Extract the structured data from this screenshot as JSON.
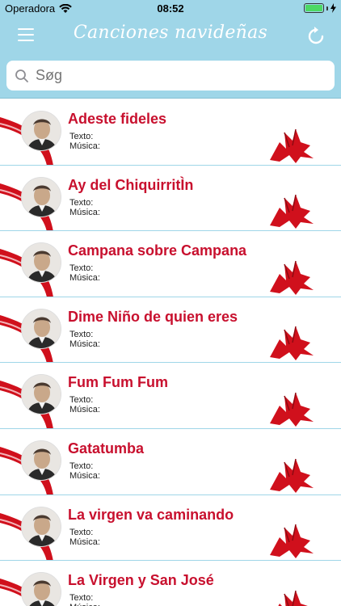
{
  "status_bar": {
    "carrier": "Operadora",
    "time": "08:52"
  },
  "nav": {
    "title": "Canciones navideñas"
  },
  "search": {
    "placeholder": "Søg"
  },
  "songs": [
    {
      "title": "Adeste fideles",
      "texto_label": "Texto:",
      "musica_label": "Música:"
    },
    {
      "title": "Ay del ChiquirritÌn",
      "texto_label": "Texto:",
      "musica_label": "Música:"
    },
    {
      "title": "Campana sobre Campana",
      "texto_label": "Texto:",
      "musica_label": "Música:"
    },
    {
      "title": "Dime Niño de quien eres",
      "texto_label": "Texto:",
      "musica_label": "Música:"
    },
    {
      "title": "Fum Fum Fum",
      "texto_label": "Texto:",
      "musica_label": "Música:"
    },
    {
      "title": "Gatatumba",
      "texto_label": "Texto:",
      "musica_label": "Música:"
    },
    {
      "title": "La virgen va caminando",
      "texto_label": "Texto:",
      "musica_label": "Música:"
    },
    {
      "title": "La Virgen y San José",
      "texto_label": "Texto:",
      "musica_label": "Música:"
    }
  ],
  "colors": {
    "header_bg": "#9fd6e8",
    "title_red": "#c8102e",
    "ribbon_red": "#d0101c"
  }
}
